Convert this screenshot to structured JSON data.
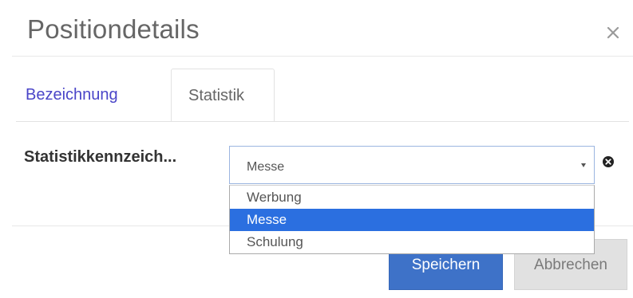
{
  "dialog": {
    "title": "Positiondetails",
    "close_symbol": "×"
  },
  "tabs": [
    {
      "label": "Bezeichnung",
      "active": false
    },
    {
      "label": "Statistik",
      "active": true
    }
  ],
  "form": {
    "field_label": "Statistikkennzeich...",
    "select": {
      "value": "Messe",
      "options": [
        "Werbung",
        "Messe",
        "Schulung"
      ],
      "highlighted": "Messe",
      "clear_icon": "times-circle-icon"
    }
  },
  "footer": {
    "save_label": "Speichern",
    "cancel_label": "Abbrechen"
  },
  "colors": {
    "primary": "#3e72c8",
    "highlight": "#2b6fe0",
    "tab_link": "#4a45c8"
  }
}
